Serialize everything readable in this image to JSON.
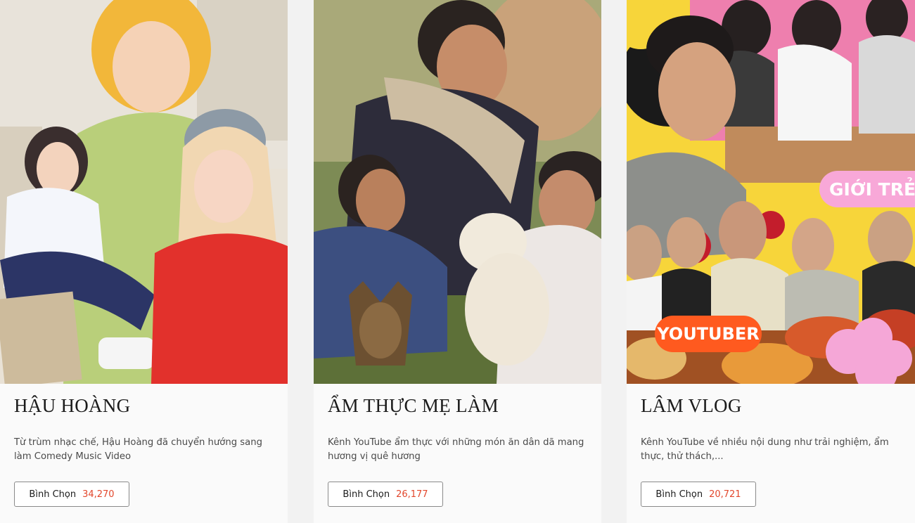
{
  "cards": [
    {
      "title": "HẬU HOÀNG",
      "description": "Từ trùm nhạc chế, Hậu Hoàng đã chuyển hướng sang làm Comedy Music Video",
      "vote_label": "Bình Chọn",
      "vote_count": "34,270"
    },
    {
      "title": "ẨM THỰC MẸ LÀM",
      "description": "Kênh YouTube ẩm thực với những món ăn dân dã mang hương vị quê hương",
      "vote_label": "Bình Chọn",
      "vote_count": "26,177"
    },
    {
      "title": "LÂM VLOG",
      "description": "Kênh YouTube về nhiều nội dung như trải nghiệm, ẩm thực, thử thách,...",
      "vote_label": "Bình Chọn",
      "vote_count": "20,721",
      "badges": {
        "youtuber": "YOUTUBER",
        "gioi_tre": "GIỚI TRẺ"
      }
    }
  ],
  "colors": {
    "vote_count": "#e2472c",
    "background": "#f2f2f2",
    "card": "#fafafa"
  }
}
